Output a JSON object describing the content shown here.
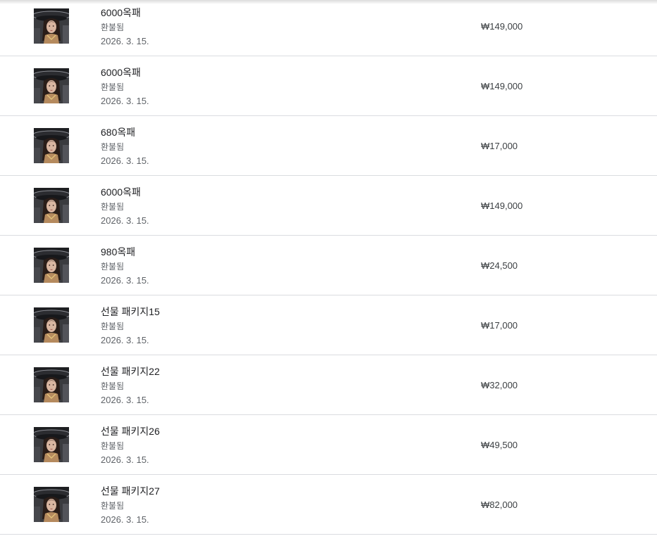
{
  "purchases": [
    {
      "title": "6000옥패",
      "status": "환불됨",
      "date": "2026. 3. 15.",
      "price": "₩149,000",
      "icon": "game-app-icon"
    },
    {
      "title": "6000옥패",
      "status": "환불됨",
      "date": "2026. 3. 15.",
      "price": "₩149,000",
      "icon": "game-app-icon"
    },
    {
      "title": "680옥패",
      "status": "환불됨",
      "date": "2026. 3. 15.",
      "price": "₩17,000",
      "icon": "game-app-icon"
    },
    {
      "title": "6000옥패",
      "status": "환불됨",
      "date": "2026. 3. 15.",
      "price": "₩149,000",
      "icon": "game-app-icon"
    },
    {
      "title": "980옥패",
      "status": "환불됨",
      "date": "2026. 3. 15.",
      "price": "₩24,500",
      "icon": "game-app-icon"
    },
    {
      "title": "선물 패키지15",
      "status": "환불됨",
      "date": "2026. 3. 15.",
      "price": "₩17,000",
      "icon": "game-app-icon"
    },
    {
      "title": "선물 패키지22",
      "status": "환불됨",
      "date": "2026. 3. 15.",
      "price": "₩32,000",
      "icon": "game-app-icon"
    },
    {
      "title": "선물 패키지26",
      "status": "환불됨",
      "date": "2026. 3. 15.",
      "price": "₩49,500",
      "icon": "game-app-icon"
    },
    {
      "title": "선물 패키지27",
      "status": "환불됨",
      "date": "2026. 3. 15.",
      "price": "₩82,000",
      "icon": "game-app-icon"
    }
  ]
}
